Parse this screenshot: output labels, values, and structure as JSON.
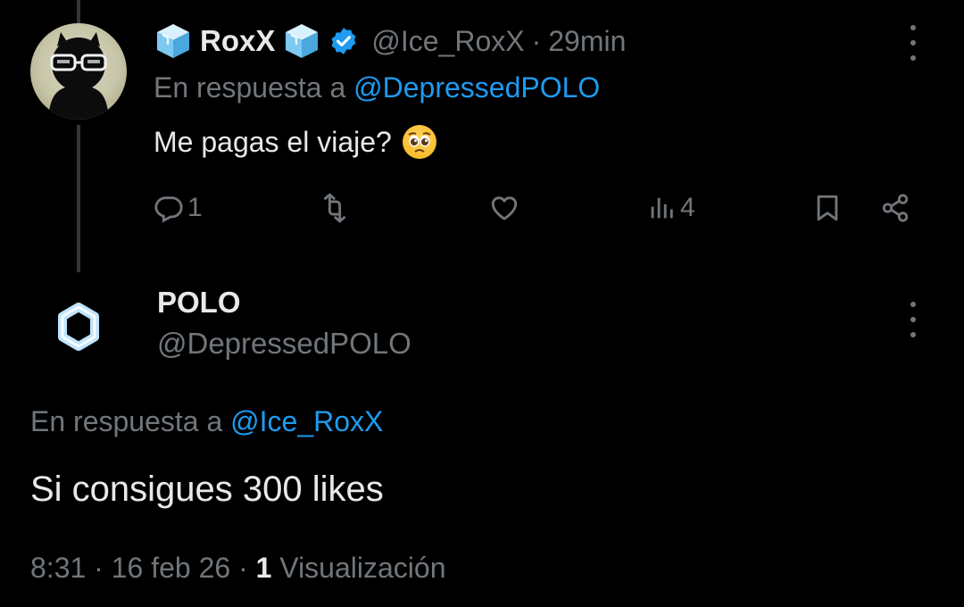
{
  "tweet1": {
    "display_name": "RoxX",
    "name_emoji": "ice-cube",
    "verified": true,
    "handle": "@Ice_RoxX",
    "separator": "·",
    "time": "29min",
    "reply_prefix": "En respuesta a",
    "reply_to": "@DepressedPOLO",
    "text": "Me pagas el viaje?",
    "text_emoji": "pleading-face",
    "reply_count": "1",
    "view_count": "4"
  },
  "tweet2": {
    "display_name": "POLO",
    "handle": "@DepressedPOLO",
    "reply_prefix": "En respuesta a",
    "reply_to": "@Ice_RoxX",
    "text": "Si consigues 300 likes",
    "time": "8:31",
    "date": "16 feb 26",
    "separator": "·",
    "views_number": "1",
    "views_label": "Visualización"
  },
  "colors": {
    "background": "#000000",
    "text": "#e7e9ea",
    "muted": "#71767b",
    "link": "#1d9bf0",
    "verified": "#1d9bf0"
  }
}
